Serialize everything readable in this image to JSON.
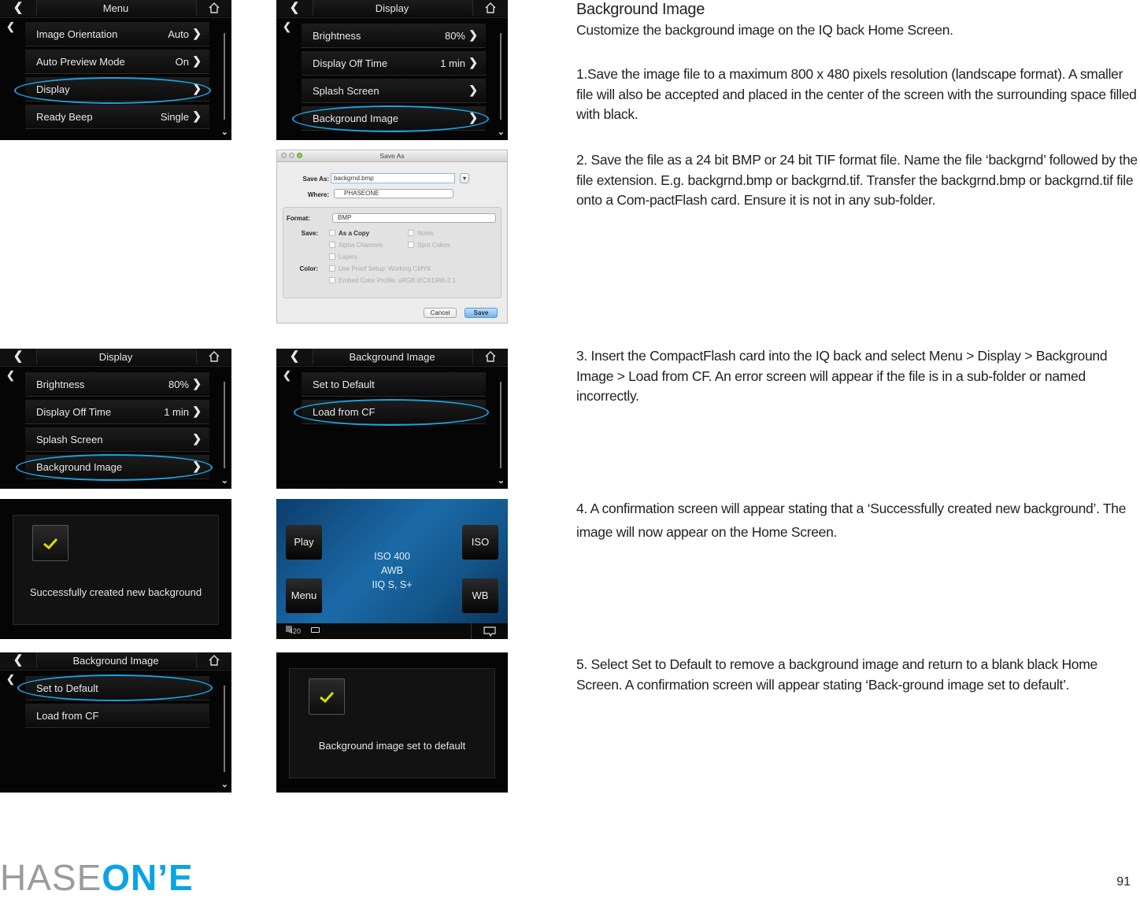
{
  "accent_colors": {
    "highlight_ellipse": "#1aa3e0",
    "logo_blue": "#0aa3e6",
    "check_yellow": "#d8e000"
  },
  "screens": {
    "menu": {
      "title": "Menu",
      "back_icon": "chevron-left-icon",
      "home_icon": "home-icon",
      "items": [
        {
          "label": "Image Orientation",
          "value": "Auto"
        },
        {
          "label": "Auto Preview Mode",
          "value": "On"
        },
        {
          "label": "Display",
          "value": ""
        },
        {
          "label": "Ready Beep",
          "value": "Single"
        }
      ],
      "highlighted": "Display"
    },
    "display": {
      "title": "Display",
      "items": [
        {
          "label": "Brightness",
          "value": "80%"
        },
        {
          "label": "Display Off Time",
          "value": "1 min"
        },
        {
          "label": "Splash Screen",
          "value": ""
        },
        {
          "label": "Background Image",
          "value": ""
        }
      ],
      "highlighted": "Background Image"
    },
    "save_as": {
      "window_title": "Save As",
      "save_as_label": "Save As:",
      "filename": "backgrnd.bmp",
      "where_label": "Where:",
      "where_value": "PHASEONE",
      "format_label": "Format:",
      "format_value": "BMP",
      "save_label": "Save:",
      "options": [
        {
          "label": "As a Copy",
          "enabled": true
        },
        {
          "label": "Notes",
          "enabled": false
        },
        {
          "label": "Alpha Channels",
          "enabled": false
        },
        {
          "label": "Spot Colors",
          "enabled": false
        },
        {
          "label": "Layers",
          "enabled": false
        }
      ],
      "color_label": "Color:",
      "color_options": [
        {
          "label": "Use Proof Setup:  Working CMYK",
          "enabled": false
        },
        {
          "label": "Embed Color Profile:  sRGB IEC61966-2.1",
          "enabled": false
        }
      ],
      "cancel_label": "Cancel",
      "save_button_label": "Save"
    },
    "display2": {
      "title": "Display",
      "items": [
        {
          "label": "Brightness",
          "value": "80%"
        },
        {
          "label": "Display Off Time",
          "value": "1 min"
        },
        {
          "label": "Splash Screen",
          "value": ""
        },
        {
          "label": "Background Image",
          "value": ""
        }
      ],
      "highlighted": "Background Image"
    },
    "bg_image": {
      "title": "Background Image",
      "items": [
        {
          "label": "Set to Default"
        },
        {
          "label": "Load from CF"
        }
      ],
      "highlighted": "Load from CF"
    },
    "success": {
      "message": "Successfully created new background"
    },
    "home": {
      "buttons": {
        "play": "Play",
        "menu": "Menu",
        "iso": "ISO",
        "wb": "WB"
      },
      "info": [
        "ISO 400",
        "AWB",
        "IIQ S, S+"
      ],
      "shots_remaining": "420"
    },
    "bg_image2": {
      "title": "Background Image",
      "items": [
        {
          "label": "Set to Default"
        },
        {
          "label": "Load from CF"
        }
      ],
      "highlighted": "Set to Default"
    },
    "default_confirm": {
      "message": "Background image set to default"
    }
  },
  "text": {
    "heading": "Background Image",
    "intro": "Customize the background image on the IQ back Home Screen.",
    "step1": "1.Save the image file to a maximum 800 x 480 pixels resolution (landscape format). A smaller file will also be accepted and placed in the center of the screen with the surrounding space filled with black.",
    "step2": "2. Save the file as a 24 bit BMP or 24 bit TIF format file. Name the file ‘backgrnd’ followed by the file extension. E.g. backgrnd.bmp or backgrnd.tif.  Transfer the  backgrnd.bmp or backgrnd.tif file onto a Com-pactFlash card. Ensure it is not in any sub-folder.",
    "step3": "3. Insert the CompactFlash card into the IQ back and select Menu > Display > Background Image > Load from CF. An error screen will appear if the file is in a sub-folder or named incorrectly.",
    "step4": "4. A confirmation screen will appear stating that a ‘Successfully created new background’. The image will now appear on the Home Screen.",
    "step5": "5. Select Set to Default to remove a background image and return to a blank black Home Screen. A confirmation screen will appear stating  ‘Back-ground image set to default’."
  },
  "footer": {
    "logo_light": "HASE",
    "logo_bold": "ON’E",
    "page_number": "91"
  }
}
